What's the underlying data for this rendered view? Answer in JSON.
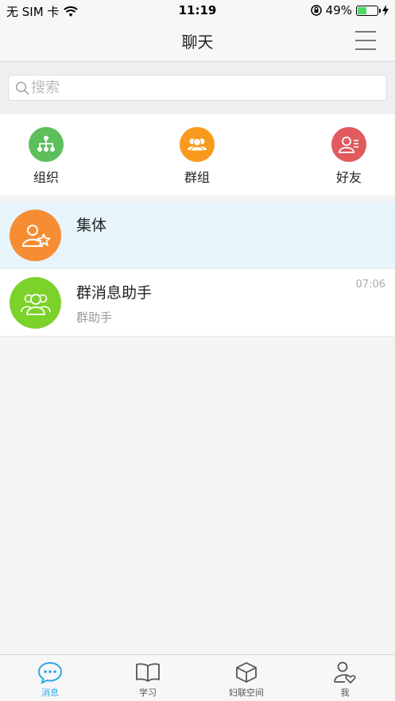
{
  "status_bar": {
    "carrier": "无 SIM 卡",
    "time": "11:19",
    "battery_percent": "49%",
    "battery_level": 0.49
  },
  "header": {
    "title": "聊天",
    "menu_icon": "hamburger-menu-icon"
  },
  "search": {
    "placeholder": "搜索",
    "icon": "search-icon"
  },
  "quick_entries": [
    {
      "label": "组织",
      "icon": "org-chart-icon",
      "color": "#5dbf5b"
    },
    {
      "label": "群组",
      "icon": "group-icon",
      "color": "#f99a1d"
    },
    {
      "label": "好友",
      "icon": "friend-list-icon",
      "color": "#e05a5e"
    }
  ],
  "chats": [
    {
      "name": "集体",
      "subtitle": "",
      "time": "",
      "avatar_icon": "person-star-icon",
      "avatar_color": "#f68d33",
      "selected": true
    },
    {
      "name": "群消息助手",
      "subtitle": "群助手",
      "time": "07:06",
      "avatar_icon": "group-people-icon",
      "avatar_color": "#7bd22a",
      "selected": false
    }
  ],
  "tabs": [
    {
      "label": "消息",
      "icon": "chat-bubble-icon",
      "active": true
    },
    {
      "label": "学习",
      "icon": "book-icon",
      "active": false
    },
    {
      "label": "妇联空间",
      "icon": "cube-icon",
      "active": false
    },
    {
      "label": "我",
      "icon": "user-heart-icon",
      "active": false
    }
  ],
  "colors": {
    "accent": "#2fa7e8",
    "selected_row": "#e8f4fc",
    "battery": "#4cd964"
  }
}
